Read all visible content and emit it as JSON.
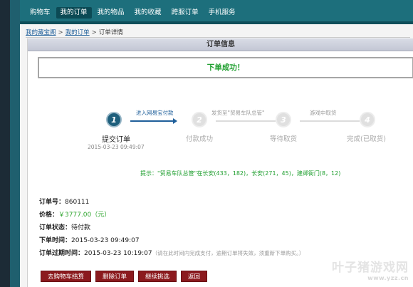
{
  "nav": {
    "items": [
      "购物车",
      "我的订单",
      "我的物品",
      "我的收藏",
      "跨服订单",
      "手机服务"
    ],
    "active_index": 1
  },
  "breadcrumb": {
    "home": "我的藏宝阁",
    "orders": "我的订单",
    "separator": ">",
    "current": "订单详情"
  },
  "panel": {
    "title": "订单信息",
    "success_message": "下单成功！"
  },
  "steps": [
    {
      "number": "1",
      "label": "提交订单",
      "time": "2015-03-23 09:49:07",
      "state": "active"
    },
    {
      "number": "2",
      "label": "付款成功",
      "state": "pending"
    },
    {
      "number": "3",
      "label": "等待取货",
      "state": "pending"
    },
    {
      "number": "4",
      "label": "完成(已取货)",
      "state": "pending"
    }
  ],
  "connectors": [
    {
      "label": "进入网易宝付款",
      "state": "active"
    },
    {
      "label": "发货至\"贸易车队总管\"",
      "state": "pending"
    },
    {
      "label": "游戏中取货",
      "state": "pending"
    }
  ],
  "tip": "提示：\"贸易车队总管\"在长安(433，182)，长安(271，45)，建邺衙门(8，12)",
  "order": {
    "number_label": "订单号：",
    "number": "860111",
    "price_label": "价格：",
    "price": "￥3777.00（元）",
    "status_label": "订单状态：",
    "status": "待付款",
    "created_label": "下单时间：",
    "created": "2015-03-23 09:49:07",
    "expire_label": "订单过期时间：",
    "expire": "2015-03-23 10:19:07",
    "expire_note": "（请在此时间内完成支付，逾期订单将失效，须重新下单购买。）"
  },
  "buttons": {
    "checkout": "去购物车结算",
    "cancel": "删除订单",
    "continue": "继续挑选",
    "back": "返回"
  },
  "watermark": {
    "brand": "叶子猪游戏网",
    "url": "www.yzz.cn"
  },
  "colors": {
    "nav_bg": "#1d6f7c",
    "accent_blue": "#1f5f9a",
    "success_green": "#1f9f2f",
    "button_red": "#8b1a1e"
  }
}
